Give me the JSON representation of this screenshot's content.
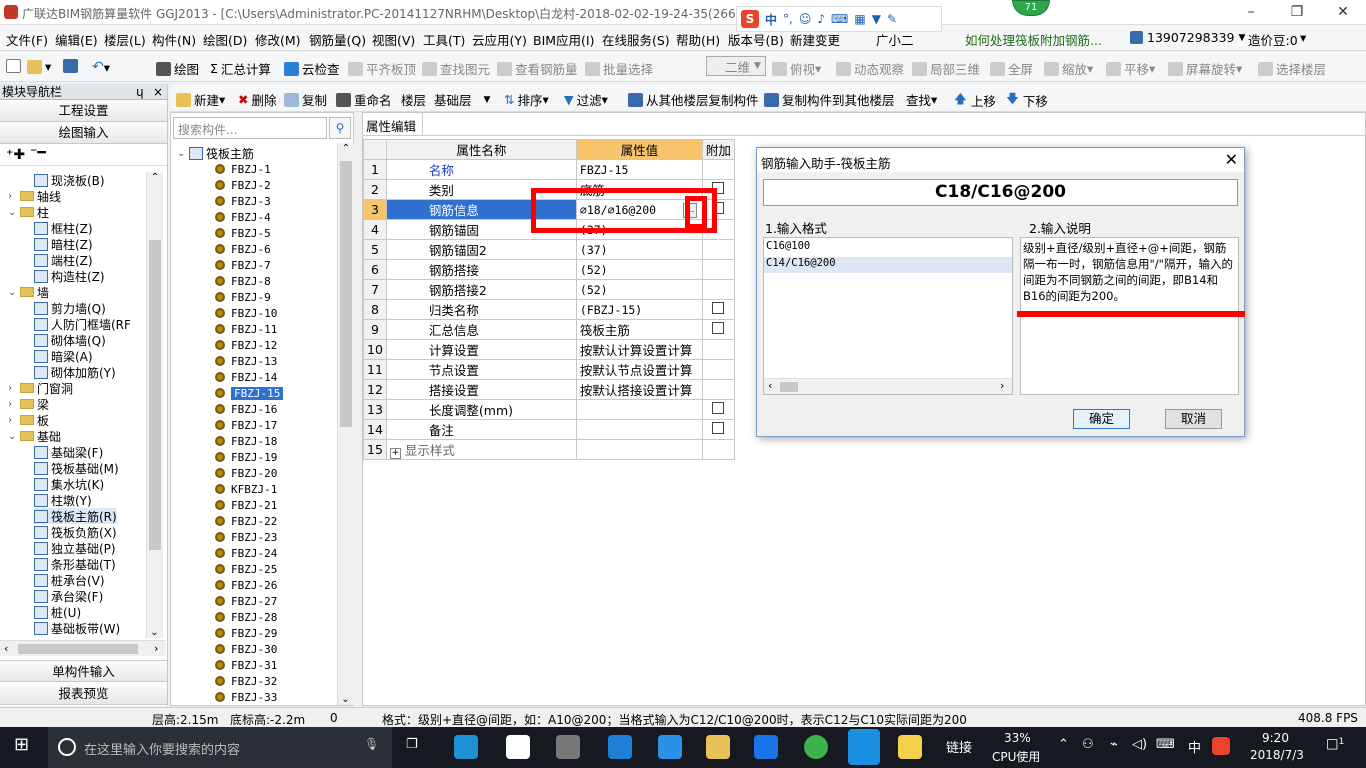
{
  "window": {
    "title": "广联达BIM钢筋算量软件 GGJ2013 - [C:\\Users\\Administrator.PC-20141127NRHM\\Desktop\\白龙村-2018-02-02-19-24-35(2666版).GGJ12]",
    "badge": "71",
    "ime_label": "中"
  },
  "menu": [
    "文件(F)",
    "编辑(E)",
    "楼层(L)",
    "构件(N)",
    "绘图(D)",
    "修改(M)",
    "钢筋量(Q)",
    "视图(V)",
    "工具(T)",
    "云应用(Y)",
    "BIM应用(I)",
    "在线服务(S)",
    "帮助(H)",
    "版本号(B)",
    "新建变更",
    "广小二"
  ],
  "menu_right": {
    "help_link": "如何处理筏板附加钢筋...",
    "phone": "13907298339",
    "cost_beans": "造价豆:0"
  },
  "toolbar1": [
    "绘图",
    "汇总计算",
    "云检查",
    "平齐板顶",
    "查找图元",
    "查看钢筋量",
    "批量选择",
    "二维",
    "俯视",
    "动态观察",
    "局部三维",
    "全屏",
    "缩放",
    "平移",
    "屏幕旋转",
    "选择楼层"
  ],
  "toolbar2": [
    "新建",
    "删除",
    "复制",
    "重命名",
    "楼层",
    "基础层",
    "排序",
    "过滤",
    "从其他楼层复制构件",
    "复制构件到其他楼层",
    "查找",
    "上移",
    "下移"
  ],
  "nav": {
    "title": "模块导航栏",
    "pin": "ɥ",
    "close": "×",
    "btn_project": "工程设置",
    "btn_draw": "绘图输入",
    "btn_single": "单构件输入",
    "btn_report": "报表预览",
    "tree": [
      {
        "label": "现浇板(B)",
        "indent": 3
      },
      {
        "label": "轴线",
        "indent": 1,
        "folder": true,
        "exp": "+"
      },
      {
        "label": "柱",
        "indent": 1,
        "folder": true,
        "exp": "−"
      },
      {
        "label": "框柱(Z)",
        "indent": 3
      },
      {
        "label": "暗柱(Z)",
        "indent": 3
      },
      {
        "label": "端柱(Z)",
        "indent": 3
      },
      {
        "label": "构造柱(Z)",
        "indent": 3
      },
      {
        "label": "墙",
        "indent": 1,
        "folder": true,
        "exp": "−"
      },
      {
        "label": "剪力墙(Q)",
        "indent": 3
      },
      {
        "label": "人防门框墙(RF",
        "indent": 3
      },
      {
        "label": "砌体墙(Q)",
        "indent": 3
      },
      {
        "label": "暗梁(A)",
        "indent": 3
      },
      {
        "label": "砌体加筋(Y)",
        "indent": 3
      },
      {
        "label": "门窗洞",
        "indent": 1,
        "folder": true,
        "exp": "+"
      },
      {
        "label": "梁",
        "indent": 1,
        "folder": true,
        "exp": "+"
      },
      {
        "label": "板",
        "indent": 1,
        "folder": true,
        "exp": "+"
      },
      {
        "label": "基础",
        "indent": 1,
        "folder": true,
        "exp": "−"
      },
      {
        "label": "基础梁(F)",
        "indent": 3
      },
      {
        "label": "筏板基础(M)",
        "indent": 3
      },
      {
        "label": "集水坑(K)",
        "indent": 3
      },
      {
        "label": "柱墩(Y)",
        "indent": 3
      },
      {
        "label": "筏板主筋(R)",
        "indent": 3,
        "selected": true
      },
      {
        "label": "筏板负筋(X)",
        "indent": 3
      },
      {
        "label": "独立基础(P)",
        "indent": 3
      },
      {
        "label": "条形基础(T)",
        "indent": 3
      },
      {
        "label": "桩承台(V)",
        "indent": 3
      },
      {
        "label": "承台梁(F)",
        "indent": 3
      },
      {
        "label": "桩(U)",
        "indent": 3
      },
      {
        "label": "基础板带(W)",
        "indent": 3
      }
    ]
  },
  "complist": {
    "search_placeholder": "搜索构件...",
    "root": "筏板主筋",
    "items": [
      "FBZJ-1",
      "FBZJ-2",
      "FBZJ-3",
      "FBZJ-4",
      "FBZJ-5",
      "FBZJ-6",
      "FBZJ-7",
      "FBZJ-8",
      "FBZJ-9",
      "FBZJ-10",
      "FBZJ-11",
      "FBZJ-12",
      "FBZJ-13",
      "FBZJ-14",
      "FBZJ-15",
      "FBZJ-16",
      "FBZJ-17",
      "FBZJ-18",
      "FBZJ-19",
      "FBZJ-20",
      "KFBZJ-1",
      "FBZJ-21",
      "FBZJ-22",
      "FBZJ-23",
      "FBZJ-24",
      "FBZJ-25",
      "FBZJ-26",
      "FBZJ-27",
      "FBZJ-28",
      "FBZJ-29",
      "FBZJ-30",
      "FBZJ-31",
      "FBZJ-32",
      "FBZJ-33"
    ],
    "selected_index": 14
  },
  "prop": {
    "tab": "属性编辑",
    "col_name": "属性名称",
    "col_value": "属性值",
    "col_extra": "附加",
    "rows": [
      {
        "n": "1",
        "name": "名称",
        "value": "FBZJ-15",
        "cb": false,
        "blue": true
      },
      {
        "n": "2",
        "name": "类别",
        "value": "底筋",
        "cb": true
      },
      {
        "n": "3",
        "name": "钢筋信息",
        "value": "⌀18/⌀16@200",
        "cb": true,
        "selected": true
      },
      {
        "n": "4",
        "name": "钢筋锚固",
        "value": "(37)",
        "cb": false
      },
      {
        "n": "5",
        "name": "钢筋锚固2",
        "value": "(37)",
        "cb": false
      },
      {
        "n": "6",
        "name": "钢筋搭接",
        "value": "(52)",
        "cb": false
      },
      {
        "n": "7",
        "name": "钢筋搭接2",
        "value": "(52)",
        "cb": false
      },
      {
        "n": "8",
        "name": "归类名称",
        "value": "(FBZJ-15)",
        "cb": true
      },
      {
        "n": "9",
        "name": "汇总信息",
        "value": "筏板主筋",
        "cb": true
      },
      {
        "n": "10",
        "name": "计算设置",
        "value": "按默认计算设置计算",
        "cb": false
      },
      {
        "n": "11",
        "name": "节点设置",
        "value": "按默认节点设置计算",
        "cb": false
      },
      {
        "n": "12",
        "name": "搭接设置",
        "value": "按默认搭接设置计算",
        "cb": false
      },
      {
        "n": "13",
        "name": "长度调整(mm)",
        "value": "",
        "cb": true
      },
      {
        "n": "14",
        "name": "备注",
        "value": "",
        "cb": true
      },
      {
        "n": "15",
        "name": "显示样式",
        "value": "",
        "cb": false,
        "expander": "+"
      }
    ]
  },
  "dialog": {
    "title": "钢筋输入助手-筏板主筋",
    "formula": "C18/C16@200",
    "label_format": "1.输入格式",
    "label_desc": "2.输入说明",
    "formats": [
      "C16@100",
      "C14/C16@200"
    ],
    "desc": "级别+直径/级别+直径+@+间距，钢筋隔一布一时，钢筋信息用\"/\"隔开，输入的间距为不同钢筋之间的间距，即B14和B16的间距为200。",
    "ok": "确定",
    "cancel": "取消"
  },
  "status": {
    "floor_height": "层高:2.15m",
    "base_height": "底标高:-2.2m",
    "zero": "0",
    "hint": "格式：级别+直径@间距，如：A10@200；当格式输入为C12/C10@200时，表示C12与C10实际间距为200",
    "fps": "408.8 FPS"
  },
  "taskbar": {
    "search": "在这里输入你要搜索的内容",
    "link": "链接",
    "cpu_pct": "33%",
    "cpu_label": "CPU使用",
    "lang": "中",
    "time": "9:20",
    "date": "2018/7/3",
    "notif": "1"
  },
  "colors": {
    "accent": "#2e6fd0",
    "annotation": "#ff0000",
    "header_value": "#f7c46b"
  }
}
